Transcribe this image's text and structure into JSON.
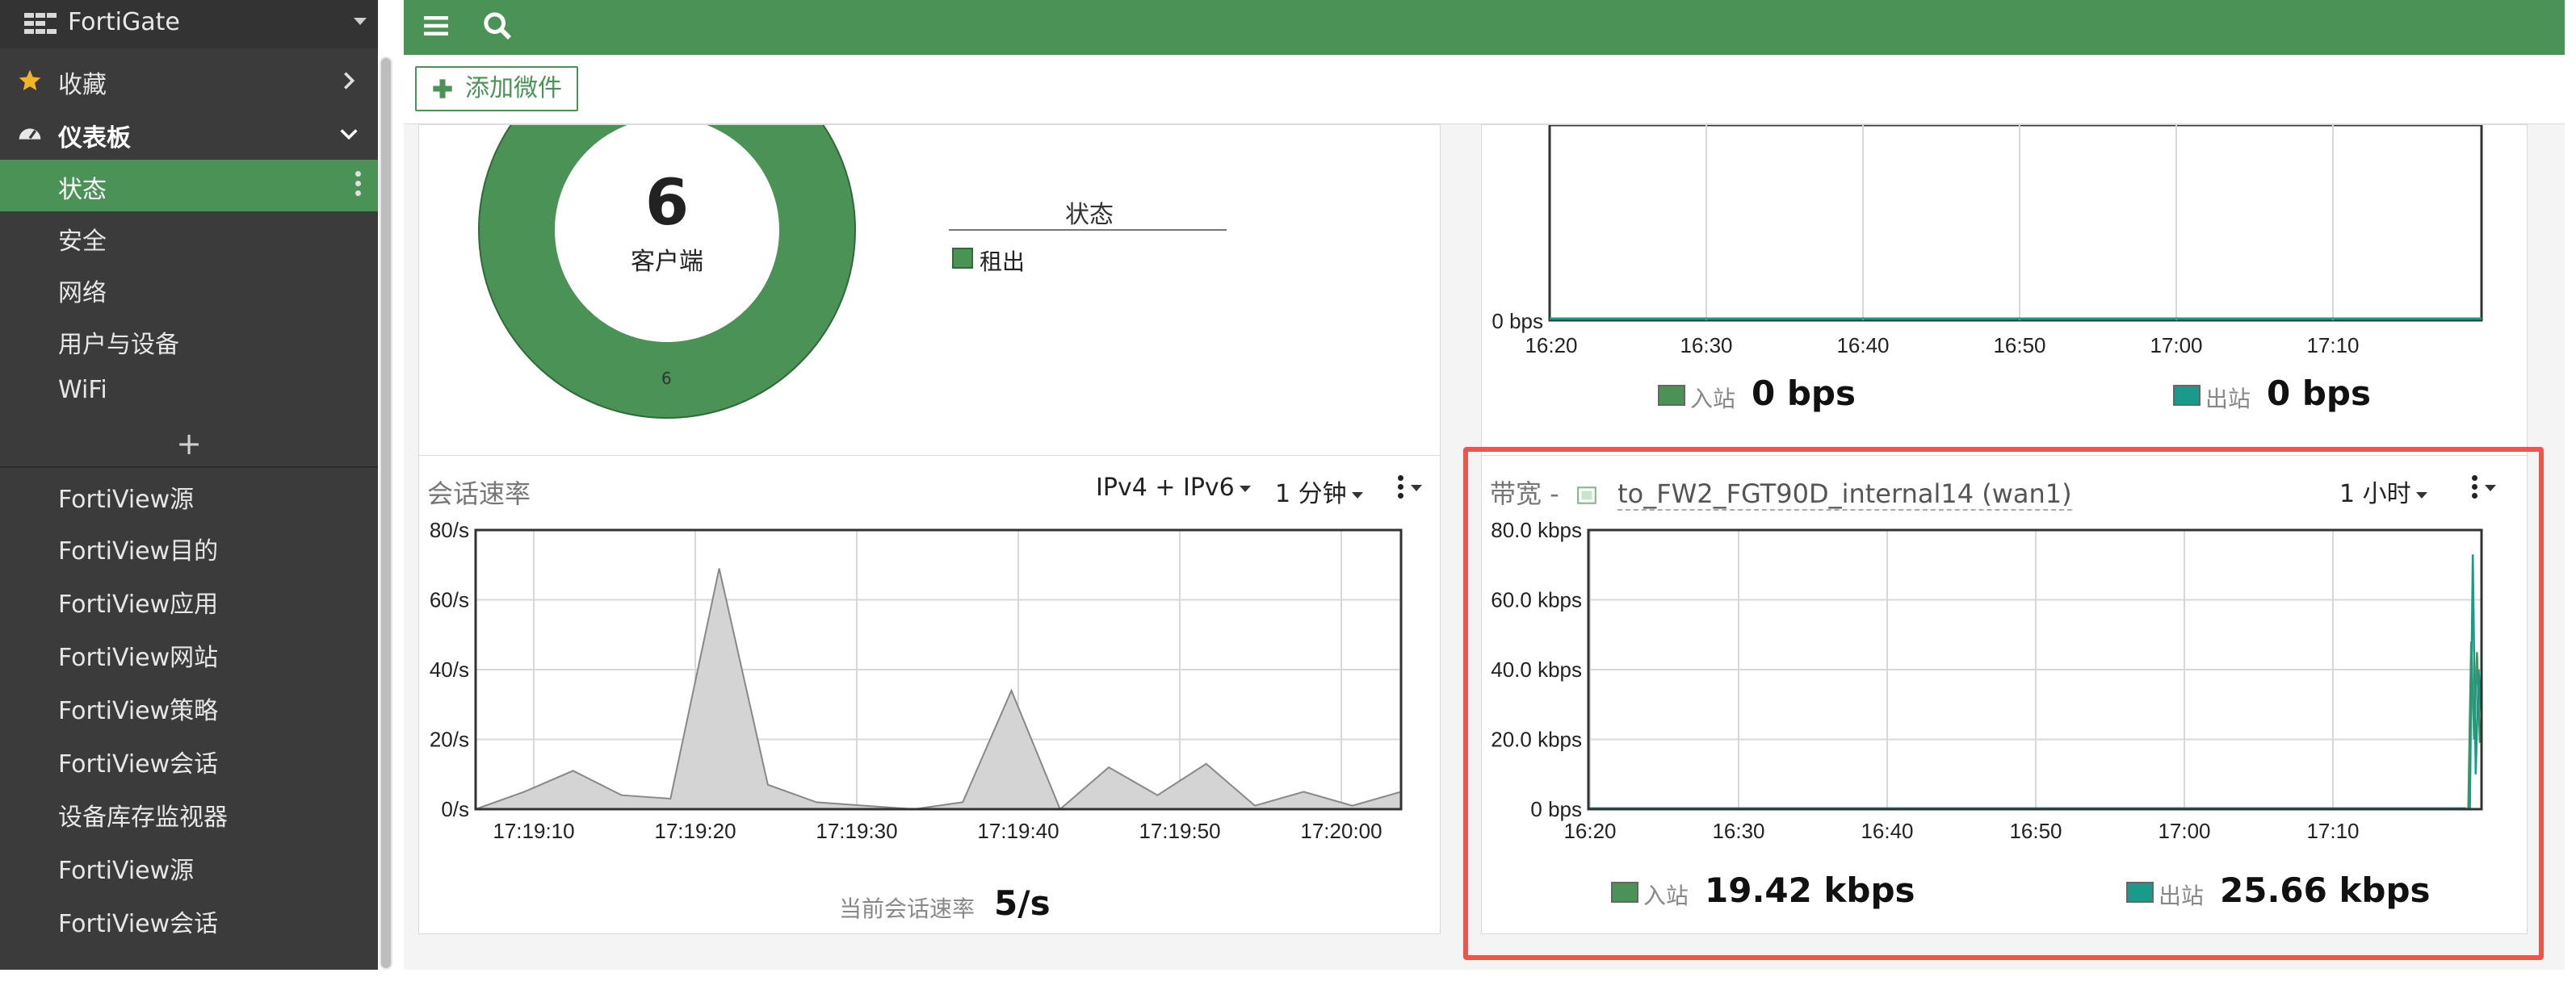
{
  "app": {
    "title": "FortiGate"
  },
  "sidebar": {
    "favorites_label": "收藏",
    "dashboard_label": "仪表板",
    "dashboard_items": [
      "状态",
      "安全",
      "网络",
      "用户与设备",
      "WiFi"
    ],
    "add_symbol": "+",
    "view_items": [
      "FortiView源",
      "FortiView目的",
      "FortiView应用",
      "FortiView网站",
      "FortiView策略",
      "FortiView会话",
      "设备库存监视器",
      "FortiView源",
      "FortiView会话"
    ]
  },
  "toolbar": {
    "add_widget_label": "添加微件"
  },
  "clients_widget": {
    "count": "6",
    "count_label": "客户端",
    "slice_label": "6",
    "legend_title": "状态",
    "legend_items": [
      {
        "label": "租出",
        "color": "#4a9255"
      }
    ]
  },
  "top_bandwidth_widget": {
    "y_zero_label": "0 bps",
    "x_labels": [
      "16:20",
      "16:30",
      "16:40",
      "16:50",
      "17:00",
      "17:10"
    ],
    "in_label": "入站",
    "in_value": "0 bps",
    "out_label": "出站",
    "out_value": "0 bps"
  },
  "session_widget": {
    "title": "会话速率",
    "ip_filter": "IPv4 + IPv6",
    "interval": "1 分钟",
    "current_label": "当前会话速率",
    "current_value": "5/s",
    "chart_data": {
      "type": "area",
      "y_labels": [
        "80/s",
        "60/s",
        "40/s",
        "20/s",
        "0/s"
      ],
      "x_labels": [
        "17:19:10",
        "17:19:20",
        "17:19:30",
        "17:19:40",
        "17:19:50",
        "17:20:00"
      ],
      "ylim": [
        0,
        80
      ],
      "grid": true,
      "values": [
        0,
        5,
        11,
        4,
        3,
        69,
        7,
        2,
        1,
        0,
        2,
        34,
        0,
        12,
        4,
        13,
        1,
        5,
        1,
        5
      ],
      "fill_color": "#d4d4d4",
      "line_color": "#888888"
    }
  },
  "bandwidth_widget": {
    "title_prefix": "带宽 -",
    "interface": "to_FW2_FGT90D_internal14 (wan1)",
    "interval": "1 小时",
    "in_label": "入站",
    "in_value": "19.42 kbps",
    "out_label": "出站",
    "out_value": "25.66 kbps",
    "chart_data": {
      "type": "line",
      "y_labels": [
        "80.0 kbps",
        "60.0 kbps",
        "40.0 kbps",
        "20.0 kbps",
        "0 bps"
      ],
      "x_labels": [
        "16:20",
        "16:30",
        "16:40",
        "16:50",
        "17:00",
        "17:10"
      ],
      "ylim": [
        0,
        80
      ],
      "grid": true,
      "series": [
        {
          "name": "入站",
          "color": "#4a9255",
          "values": [
            0,
            0,
            48,
            20,
            45,
            19
          ]
        },
        {
          "name": "出站",
          "color": "#1a9a8a",
          "values": [
            0,
            0,
            73,
            10,
            40,
            26
          ]
        }
      ]
    }
  },
  "colors": {
    "accent": "#4a9255",
    "outbound": "#1a9a8a",
    "highlight": "#e8574b"
  }
}
